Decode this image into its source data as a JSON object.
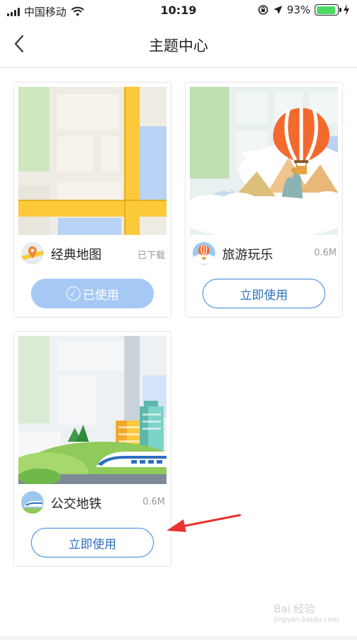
{
  "status_bar": {
    "carrier": "中国移动",
    "time": "10:19",
    "battery_percent": "93%",
    "battery_level": 0.93,
    "icons": [
      "signal-icon",
      "wifi-icon",
      "rotation-lock-icon",
      "location-icon",
      "battery-icon",
      "charging-icon"
    ]
  },
  "nav": {
    "title": "主题中心",
    "back_icon": "back-chevron-icon"
  },
  "themes": [
    {
      "name": "经典地图",
      "meta": "已下载",
      "button": "已使用",
      "state": "in-use",
      "icon": "map-pin-icon"
    },
    {
      "name": "旅游玩乐",
      "meta": "0.6M",
      "button": "立即使用",
      "state": "available",
      "icon": "hot-air-balloon-icon"
    },
    {
      "name": "公交地铁",
      "meta": "0.6M",
      "button": "立即使用",
      "state": "available",
      "icon": "train-icon"
    }
  ],
  "colors": {
    "accent": "#3a82d6",
    "used_button": "#a6c8f5",
    "road_yellow": "#fcc93a",
    "annotation_arrow": "#e8342c"
  },
  "watermark": {
    "logo": "Bai 经验",
    "url": "jingyan.baidu.com"
  }
}
